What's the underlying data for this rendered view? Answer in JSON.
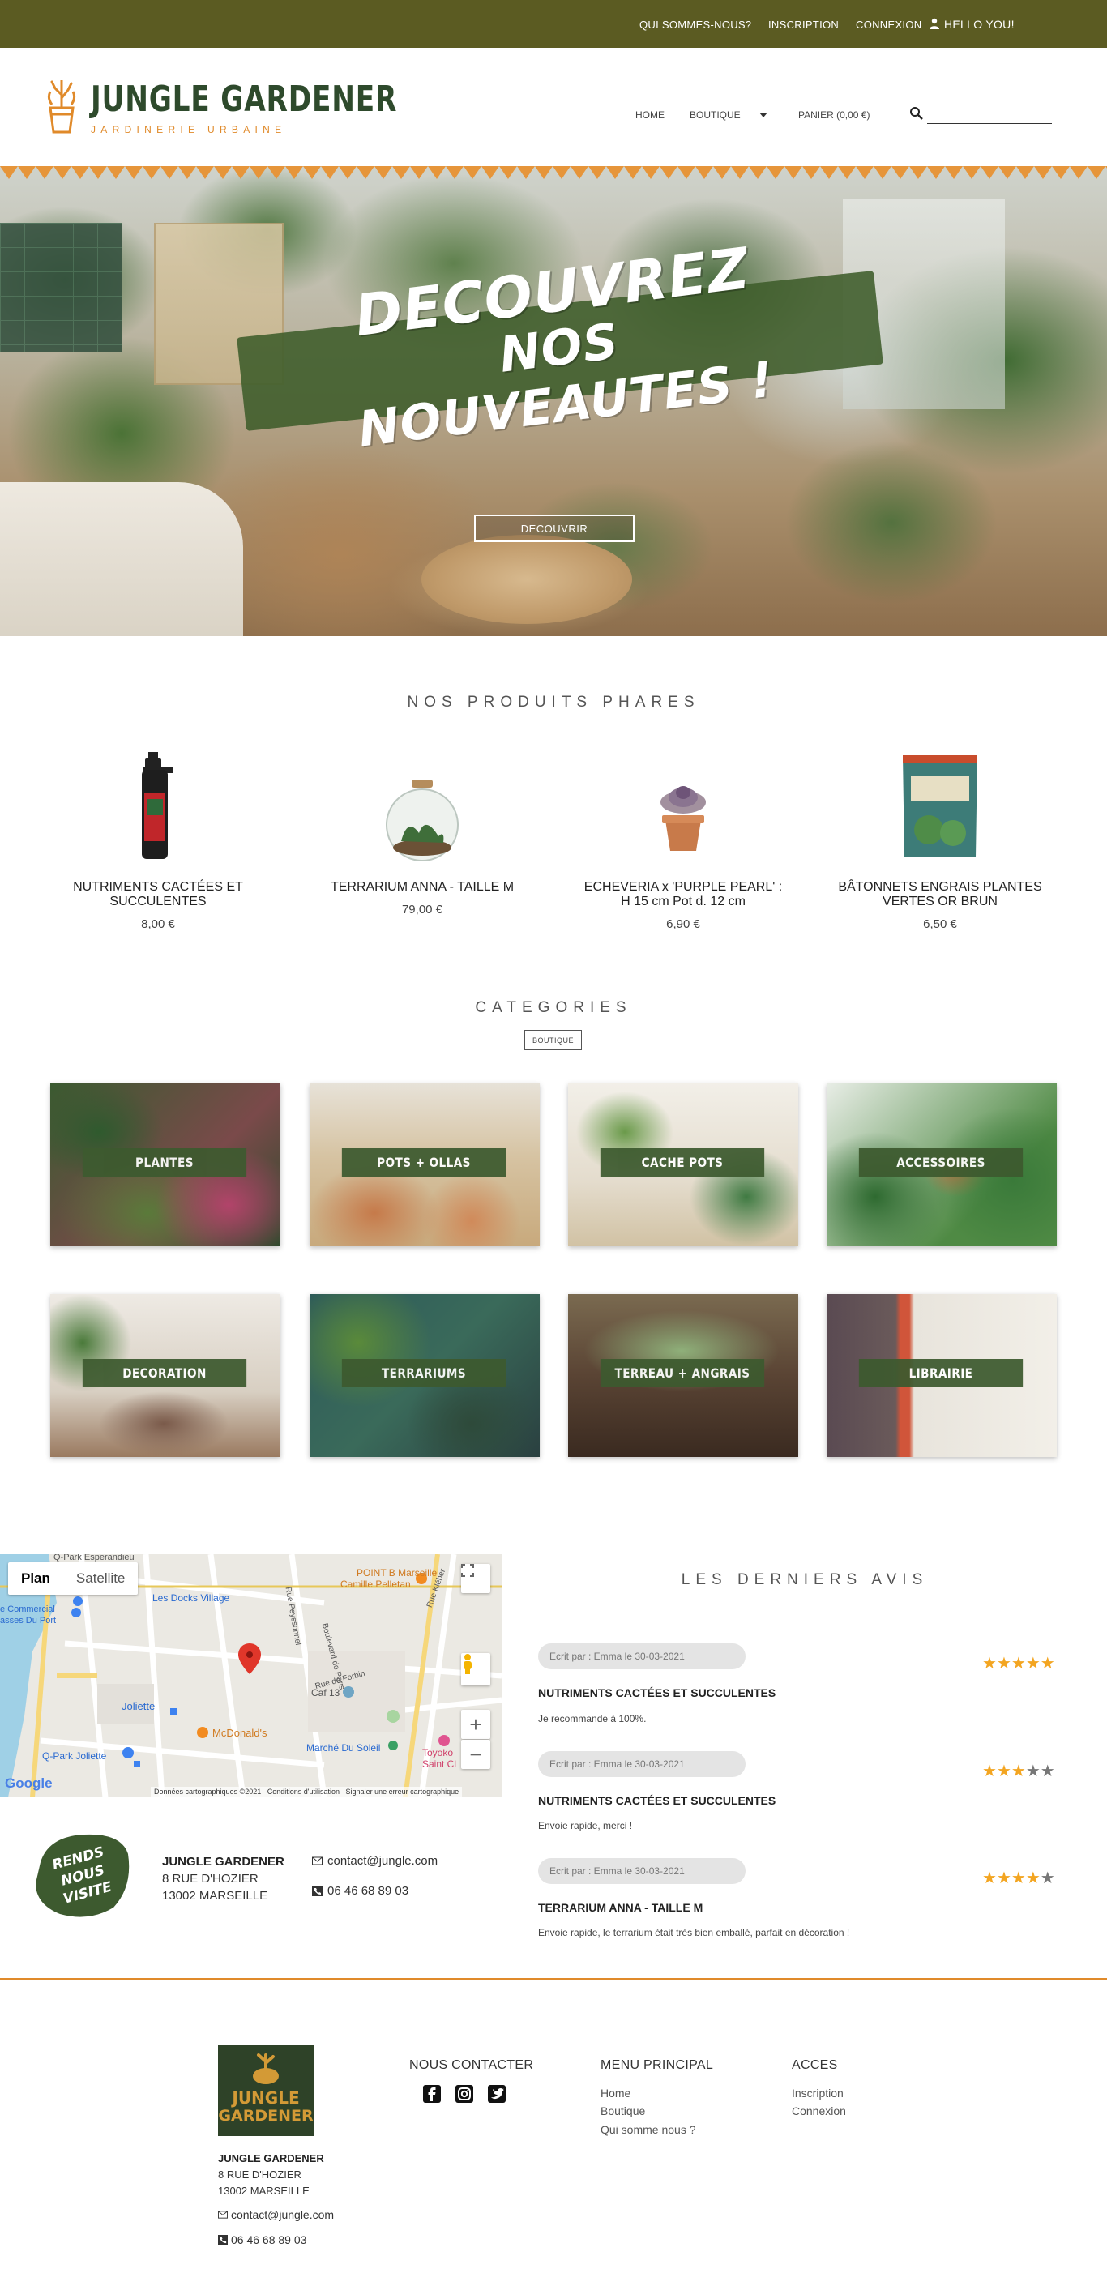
{
  "topbar": {
    "about": "QUI SOMMES-NOUS?",
    "signup": "INSCRIPTION",
    "login": "CONNEXION",
    "greeting": "HELLO YOU!"
  },
  "brand": {
    "title": "JUNGLE GARDENER",
    "subtitle": "JARDINERIE URBAINE",
    "accent": "#e08a2a",
    "green": "#3d5a2f",
    "olive": "#5b5b22"
  },
  "nav": {
    "home": "HOME",
    "shop": "BOUTIQUE",
    "cart": "PANIER (0,00 €)",
    "search_placeholder": ""
  },
  "hero": {
    "line1": "DECOUVREZ",
    "line2": "NOS NOUVEAUTES !",
    "button": "DECOUVRIR"
  },
  "products": {
    "title": "NOS PRODUITS PHARES",
    "items": [
      {
        "name": "NUTRIMENTS CACTÉES ET SUCCULENTES",
        "price": "8,00 €"
      },
      {
        "name": "TERRARIUM ANNA - TAILLE M",
        "price": "79,00 €"
      },
      {
        "name": "ECHEVERIA x 'PURPLE PEARL' : H 15 cm Pot d. 12 cm",
        "price": "6,90 €"
      },
      {
        "name": "BÂTONNETS ENGRAIS PLANTES VERTES OR BRUN",
        "price": "6,50 €"
      }
    ]
  },
  "categories": {
    "title": "CATEGORIES",
    "button": "BOUTIQUE",
    "items": [
      {
        "label": "PLANTES"
      },
      {
        "label": "POTS + OLLAS"
      },
      {
        "label": "CACHE POTS"
      },
      {
        "label": "ACCESSOIRES"
      },
      {
        "label": "DECORATION"
      },
      {
        "label": "TERRARIUMS"
      },
      {
        "label": "TERREAU + ANGRAIS"
      },
      {
        "label": "LIBRAIRIE"
      }
    ]
  },
  "map": {
    "plan": "Plan",
    "satellite": "Satellite",
    "places": {
      "park": "Q-Park Esperandieu",
      "docks": "Les Docks Village",
      "commercial": "e Commercial",
      "port": "asses Du Port",
      "pointb": "POINT B Marseille",
      "camille": "Camille Pelletan",
      "rue_forbin": "Rue de Forbin",
      "caf13": "Caf 13",
      "joliette": "Joliette",
      "mcdo": "McDonald's",
      "marche": "Marché Du Soleil",
      "qpark_joliette": "Q-Park Joliette",
      "toyoko": "Toyoko",
      "saint_charles": "Saint Cl",
      "boulevard": "Boulevard de Paris",
      "rue_kleber": "Rue Kléber",
      "rue_peyssonnel": "Rue Peyssonnel"
    },
    "attribution": {
      "data": "Données cartographiques ©2021",
      "terms": "Conditions d'utilisation",
      "report": "Signaler une erreur cartographique"
    },
    "google": "Google"
  },
  "visit": {
    "badge_line1": "RENDS",
    "badge_line2": "NOUS",
    "badge_line3": "VISITE",
    "company": "JUNGLE GARDENER",
    "street": "8 RUE D'HOZIER",
    "city": "13002 MARSEILLE",
    "email": "contact@jungle.com",
    "phone": "06 46 68 89 03"
  },
  "reviews": {
    "title": "LES DERNIERS AVIS",
    "items": [
      {
        "author": "Ecrit par : Emma le 30-03-2021",
        "product": "NUTRIMENTS CACTÉES ET SUCCULENTES",
        "text": "Je recommande à 100%.",
        "rating": 5
      },
      {
        "author": "Ecrit par : Emma le 30-03-2021",
        "product": "NUTRIMENTS CACTÉES ET SUCCULENTES",
        "text": "Envoie rapide, merci !",
        "rating": 3
      },
      {
        "author": "Ecrit par : Emma le 30-03-2021",
        "product": "TERRARIUM ANNA - TAILLE M",
        "text": "Envoie rapide, le terrarium était très bien emballé, parfait en décoration !",
        "rating": 4
      }
    ]
  },
  "footer": {
    "logo_line1": "JUNGLE",
    "logo_line2": "GARDENER",
    "company": "JUNGLE GARDENER",
    "street": "8 RUE D'HOZIER",
    "city": "13002 MARSEILLE",
    "email": "contact@jungle.com",
    "phone": "06 46 68 89 03",
    "contact_title": "NOUS CONTACTER",
    "menu_title": "MENU PRINCIPAL",
    "menu": [
      "Home",
      "Boutique",
      "Qui somme nous ?"
    ],
    "access_title": "ACCES",
    "access": [
      "Inscription",
      "Connexion"
    ]
  }
}
